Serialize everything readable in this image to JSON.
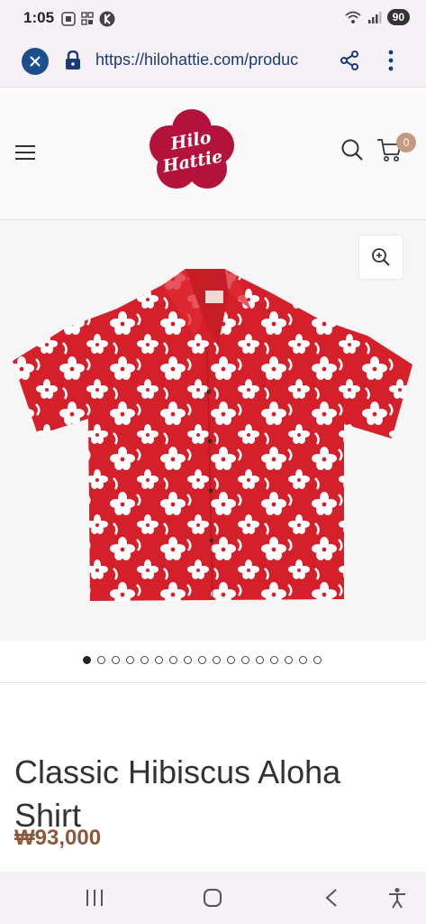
{
  "status_bar": {
    "time": "1:05",
    "battery": "90",
    "icons": [
      "screenshot-icon",
      "qr-code-icon",
      "app-k-icon",
      "wifi-icon",
      "signal-icon"
    ]
  },
  "browser": {
    "url": "https://hilohattie.com/produc",
    "icons": [
      "close-icon",
      "lock-icon",
      "share-icon",
      "more-vert-icon"
    ]
  },
  "header": {
    "logo_text_line1": "Hilo",
    "logo_text_line2": "Hattie",
    "cart_count": "0",
    "brand_color": "#b3123c"
  },
  "gallery": {
    "image_alt": "Classic Hibiscus Aloha Shirt red with white hibiscus print",
    "dot_count": 17,
    "active_dot": 0
  },
  "product": {
    "title": "Classic Hibiscus Aloha Shirt",
    "price": "₩93,000"
  },
  "colors": {
    "price": "#8a5a3a",
    "shirt_red": "#d3202a",
    "accent_blue": "#1c4f8c"
  }
}
